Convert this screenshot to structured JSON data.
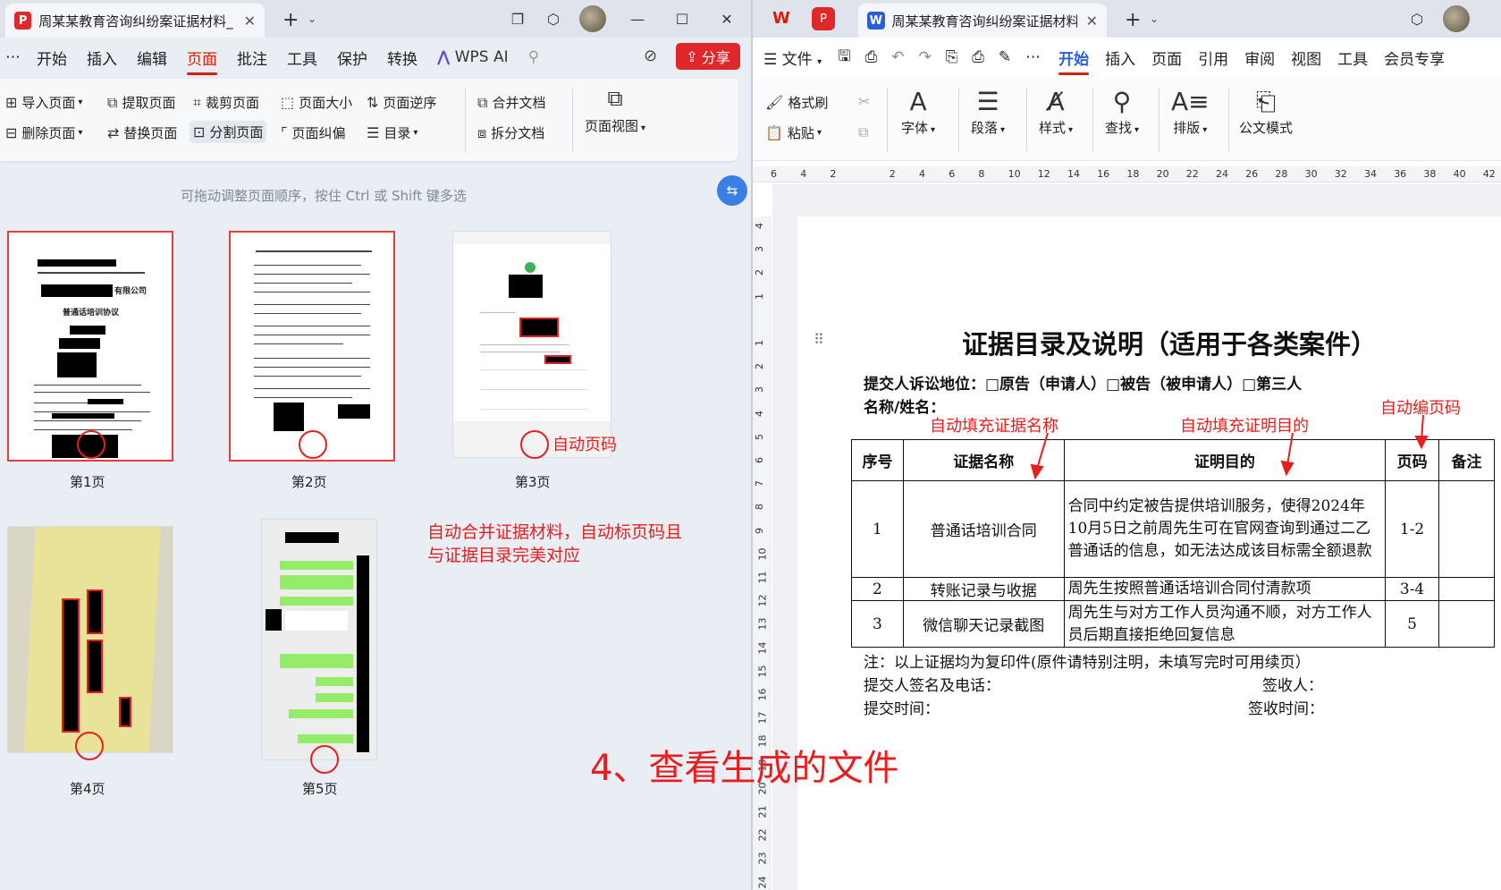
{
  "left": {
    "tab_title": "周某某教育咨询纠纷案证据材料_",
    "menu": [
      "开始",
      "插入",
      "编辑",
      "页面",
      "批注",
      "工具",
      "保护",
      "转换",
      "WPS AI"
    ],
    "menu_more": "⋯",
    "active_menu": "页面",
    "share_label": "分享",
    "ribbon": {
      "row1": [
        "导入页面",
        "提取页面",
        "裁剪页面",
        "页面大小",
        "页面逆序",
        "合并文档"
      ],
      "row2": [
        "删除页面",
        "替换页面",
        "分割页面",
        "页面纠偏",
        "目录",
        "拆分文档"
      ],
      "view_label": "页面视图"
    },
    "hint": "可拖动调整页面顺序，按住 Ctrl 或 Shift 键多选",
    "pages": [
      "第1页",
      "第2页",
      "第3页",
      "第4页",
      "第5页"
    ],
    "thumb1": {
      "company": "有限公司",
      "doc": "普通话培训协议"
    }
  },
  "annotations": {
    "auto_page_number": "自动页码",
    "merge_line1": "自动合并证据材料，自动标页码且",
    "merge_line2": "与证据目录完美对应",
    "step": "4、查看生成的文件",
    "auto_fill_name": "自动填充证据名称",
    "auto_fill_purpose": "自动填充证明目的",
    "auto_page_code": "自动编页码"
  },
  "right": {
    "tab_title": "周某某教育咨询纠纷案证据材料_",
    "menu_file": "文件",
    "menu": [
      "开始",
      "插入",
      "页面",
      "引用",
      "审阅",
      "视图",
      "工具",
      "会员专享"
    ],
    "active_menu": "开始",
    "ribbon": {
      "format_painter": "格式刷",
      "paste": "粘贴",
      "font": "字体",
      "paragraph": "段落",
      "style": "样式",
      "find": "查找",
      "layout": "排版",
      "official": "公文模式"
    },
    "ruler_ticks": [
      "6",
      "4",
      "2",
      "",
      "2",
      "4",
      "6",
      "8",
      "10",
      "12",
      "14",
      "16",
      "18",
      "20",
      "22",
      "24",
      "26",
      "28",
      "30",
      "32",
      "34",
      "36",
      "38",
      "40",
      "42"
    ],
    "vruler_ticks": [
      "4",
      "3",
      "2",
      "1",
      "",
      "1",
      "2",
      "3",
      "4",
      "5",
      "6",
      "7",
      "8",
      "9",
      "10",
      "11",
      "12",
      "13",
      "14",
      "15",
      "16",
      "17",
      "18",
      "19",
      "20",
      "21",
      "22",
      "23",
      "24"
    ]
  },
  "doc": {
    "title": "证据目录及说明（适用于各类案件）",
    "status_line": "提交人诉讼地位：□原告（申请人）□被告（被申请人）□第三人",
    "name_line": "名称/姓名：",
    "headers": [
      "序号",
      "证据名称",
      "证明目的",
      "页码",
      "备注"
    ],
    "rows": [
      {
        "no": "1",
        "name": "普通话培训合同",
        "purpose": "合同中约定被告提供培训服务，使得2024年10月5日之前周先生可在官网查询到通过二乙普通话的信息，如无法达成该目标需全额退款",
        "pages": "1-2",
        "note": ""
      },
      {
        "no": "2",
        "name": "转账记录与收据",
        "purpose": "周先生按照普通话培训合同付清款项",
        "pages": "3-4",
        "note": ""
      },
      {
        "no": "3",
        "name": "微信聊天记录截图",
        "purpose": "周先生与对方工作人员沟通不顺，对方工作人员后期直接拒绝回复信息",
        "pages": "5",
        "note": ""
      }
    ],
    "note": "注：以上证据均为复印件(原件请特别注明，未填写完时可用续页）",
    "signer": "提交人签名及电话：",
    "receiver": "签收人：",
    "submit_time": "提交时间：",
    "receive_time": "签收时间："
  },
  "colors": {
    "accent_red": "#e51f1f",
    "wps_red": "#d81e06",
    "word_blue": "#2b5fd9"
  }
}
